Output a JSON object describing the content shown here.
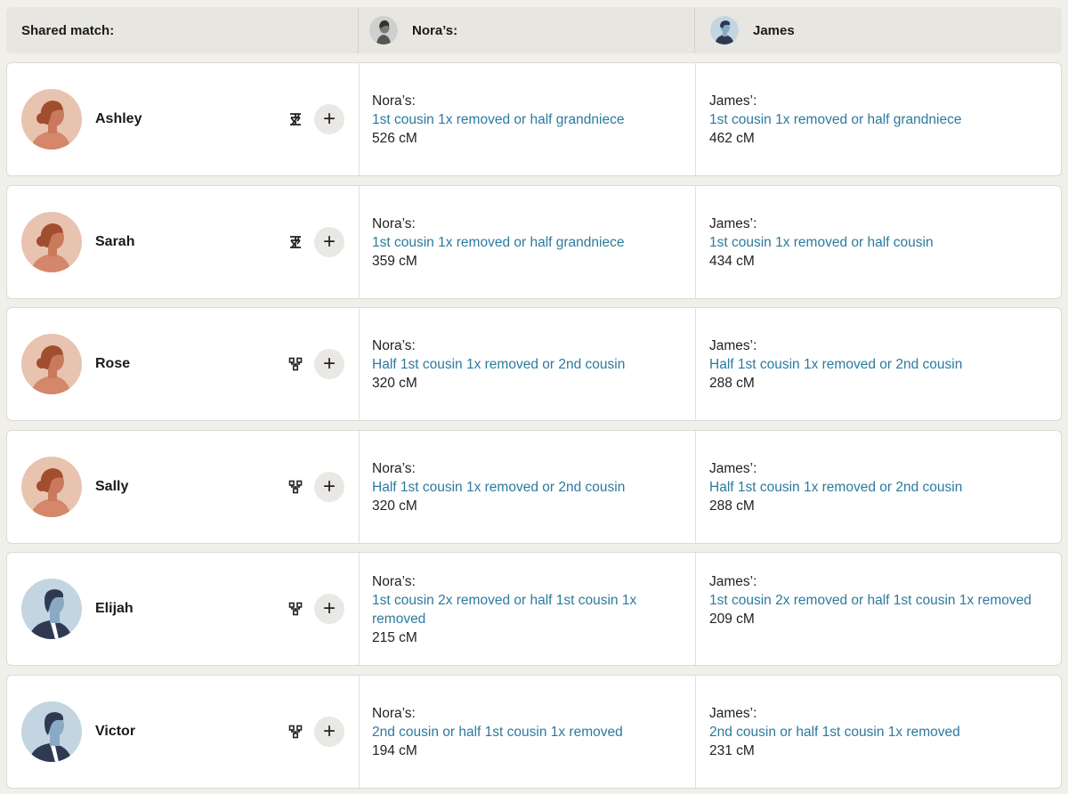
{
  "header": {
    "shared_match_label": "Shared match:",
    "person1_label": "Nora’s:",
    "person2_label": "James"
  },
  "rows": [
    {
      "name": "Ashley",
      "gender": "female",
      "icon": "tree-split-icon",
      "p1_label": "Nora’s:",
      "p1_rel": "1st cousin 1x removed or half grandniece",
      "p1_cm": "526 cM",
      "p2_label": "James’:",
      "p2_rel": "1st cousin 1x removed or half grandniece",
      "p2_cm": "462 cM"
    },
    {
      "name": "Sarah",
      "gender": "female",
      "icon": "tree-split-icon",
      "p1_label": "Nora’s:",
      "p1_rel": "1st cousin 1x removed or half grandniece",
      "p1_cm": "359 cM",
      "p2_label": "James’:",
      "p2_rel": "1st cousin 1x removed or half cousin",
      "p2_cm": "434 cM"
    },
    {
      "name": "Rose",
      "gender": "female",
      "icon": "tree-network-icon",
      "p1_label": "Nora’s:",
      "p1_rel": "Half 1st cousin 1x removed or 2nd cousin",
      "p1_cm": "320 cM",
      "p2_label": "James’:",
      "p2_rel": "Half 1st cousin 1x removed or 2nd cousin",
      "p2_cm": "288 cM"
    },
    {
      "name": "Sally",
      "gender": "female",
      "icon": "tree-network-icon",
      "p1_label": "Nora’s:",
      "p1_rel": "Half 1st cousin 1x removed or 2nd cousin",
      "p1_cm": "320 cM",
      "p2_label": "James’:",
      "p2_rel": "Half 1st cousin 1x removed or 2nd cousin",
      "p2_cm": "288 cM"
    },
    {
      "name": "Elijah",
      "gender": "male",
      "icon": "tree-network-icon",
      "p1_label": "Nora’s:",
      "p1_rel": "1st cousin 2x removed or half 1st cousin 1x removed",
      "p1_cm": "215 cM",
      "p2_label": "James’:",
      "p2_rel": "1st cousin 2x removed or half 1st cousin 1x removed",
      "p2_cm": "209 cM"
    },
    {
      "name": "Victor",
      "gender": "male",
      "icon": "tree-network-icon",
      "p1_label": "Nora’s:",
      "p1_rel": "2nd cousin or half 1st cousin 1x removed",
      "p1_cm": "194 cM",
      "p2_label": "James’:",
      "p2_rel": "2nd cousin or half 1st cousin 1x removed",
      "p2_cm": "231 cM"
    }
  ],
  "add_button_symbol": "+",
  "colors": {
    "link": "#2c7a9e",
    "female_avatar_bg": "#e8c3b0",
    "male_avatar_bg": "#c3d5e0",
    "page_bg": "#f0efea"
  }
}
